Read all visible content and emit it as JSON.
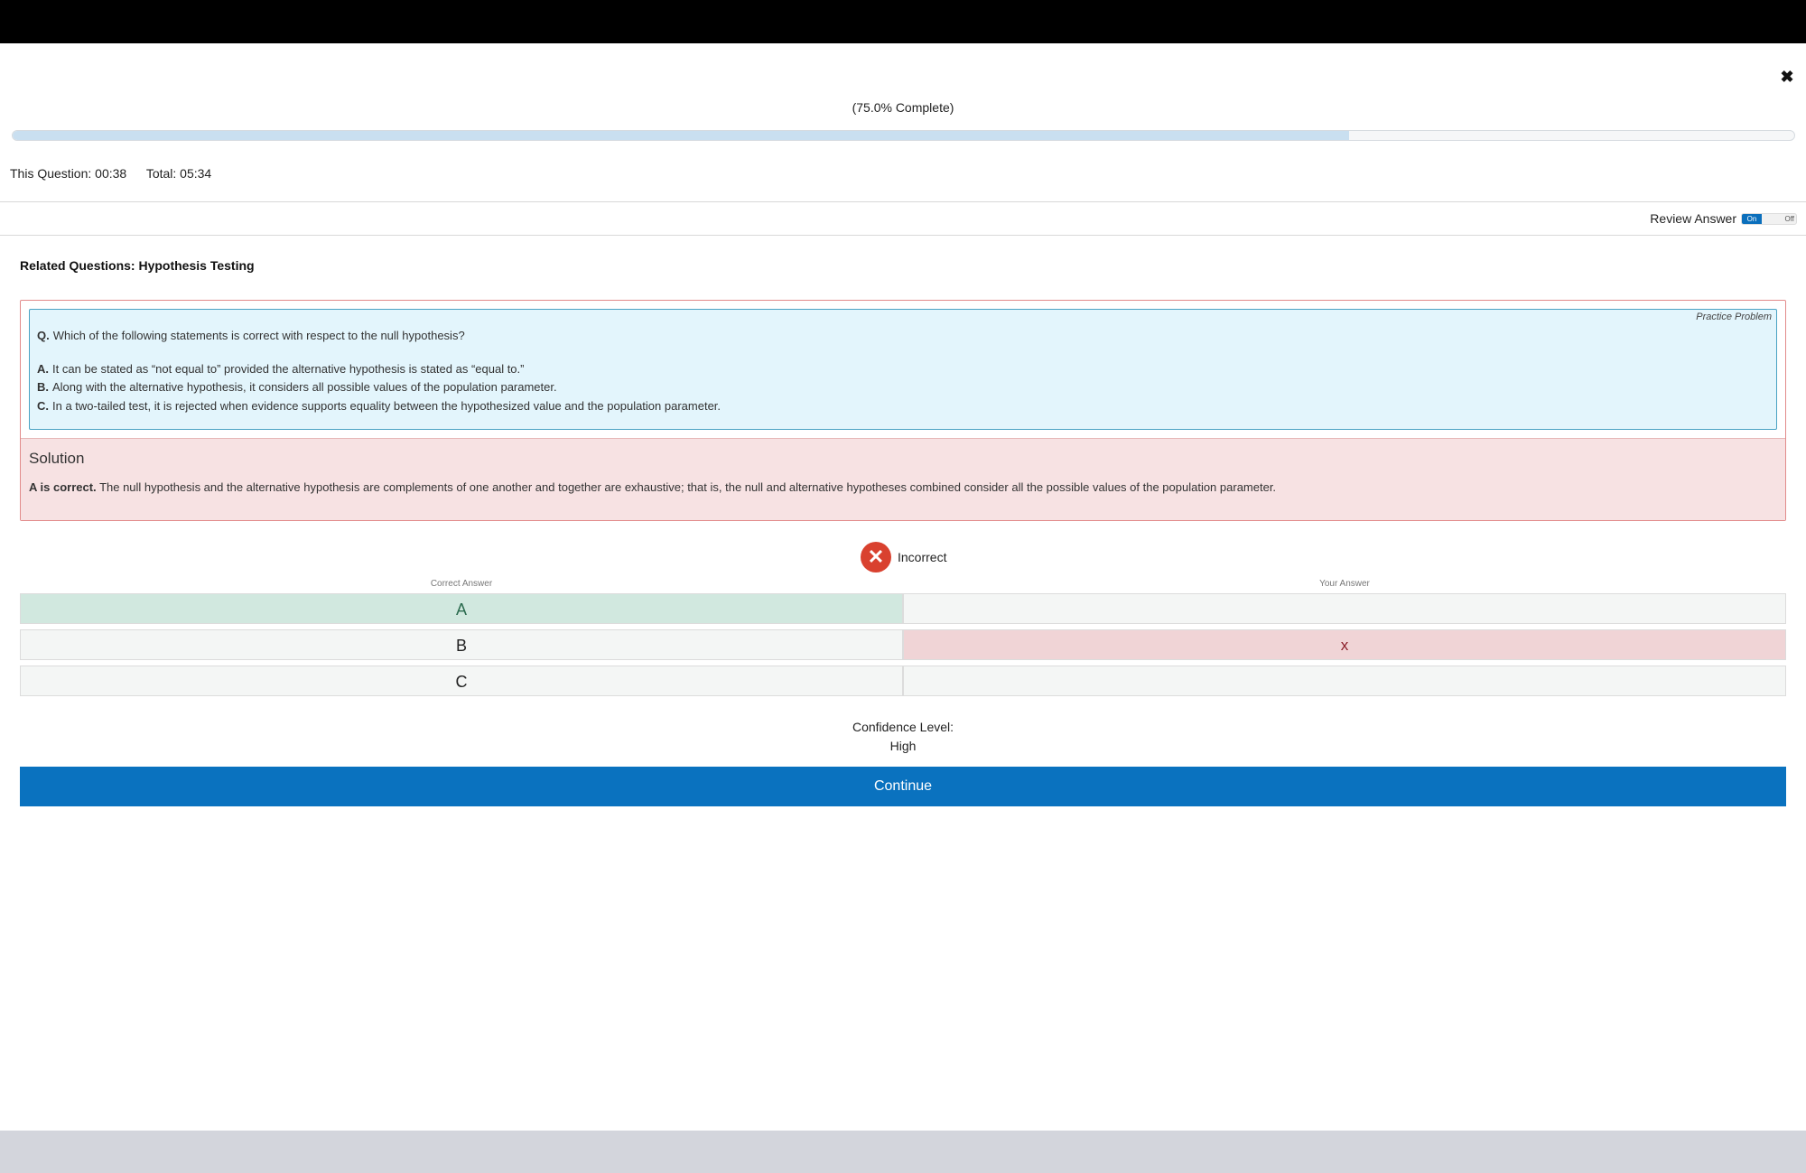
{
  "progress": {
    "label": "(75.0% Complete)",
    "percent": 75.0
  },
  "timers": {
    "this_question": "This Question: 00:38",
    "total": "Total: 05:34"
  },
  "review": {
    "label": "Review Answer",
    "on": "On",
    "off": "Off"
  },
  "related": "Related Questions: Hypothesis Testing",
  "question": {
    "practice_label": "Practice Problem",
    "prefix": "Q.",
    "text": "Which of the following statements is correct with respect to the null hypothesis?",
    "options": [
      {
        "letter": "A.",
        "text": "It can be stated as “not equal to” provided the alternative hypothesis is stated as “equal to.”"
      },
      {
        "letter": "B.",
        "text": "Along with the alternative hypothesis, it considers all possible values of the population parameter."
      },
      {
        "letter": "C.",
        "text": "In a two-tailed test, it is rejected when evidence supports equality between the hypothesized value and the population parameter."
      }
    ]
  },
  "solution": {
    "title": "Solution",
    "lead": "A is correct.",
    "text": "The null hypothesis and the alternative hypothesis are complements of one another and together are exhaustive; that is, the null and alternative hypotheses combined consider all the possible values of the population parameter."
  },
  "result": {
    "icon": "x-circle-icon",
    "text": "Incorrect",
    "color": "#d9412f"
  },
  "answers": {
    "correct_header": "Correct Answer",
    "your_header": "Your Answer",
    "rows": [
      {
        "correct": "A",
        "yours": ""
      },
      {
        "correct": "B",
        "yours": "x"
      },
      {
        "correct": "C",
        "yours": ""
      }
    ]
  },
  "confidence": {
    "label": "Confidence Level:",
    "value": "High"
  },
  "continue_label": "Continue",
  "colors": {
    "accent": "#0a72bf",
    "correct_bg": "#d1e8df",
    "wrong_bg": "#f0d4d6"
  }
}
